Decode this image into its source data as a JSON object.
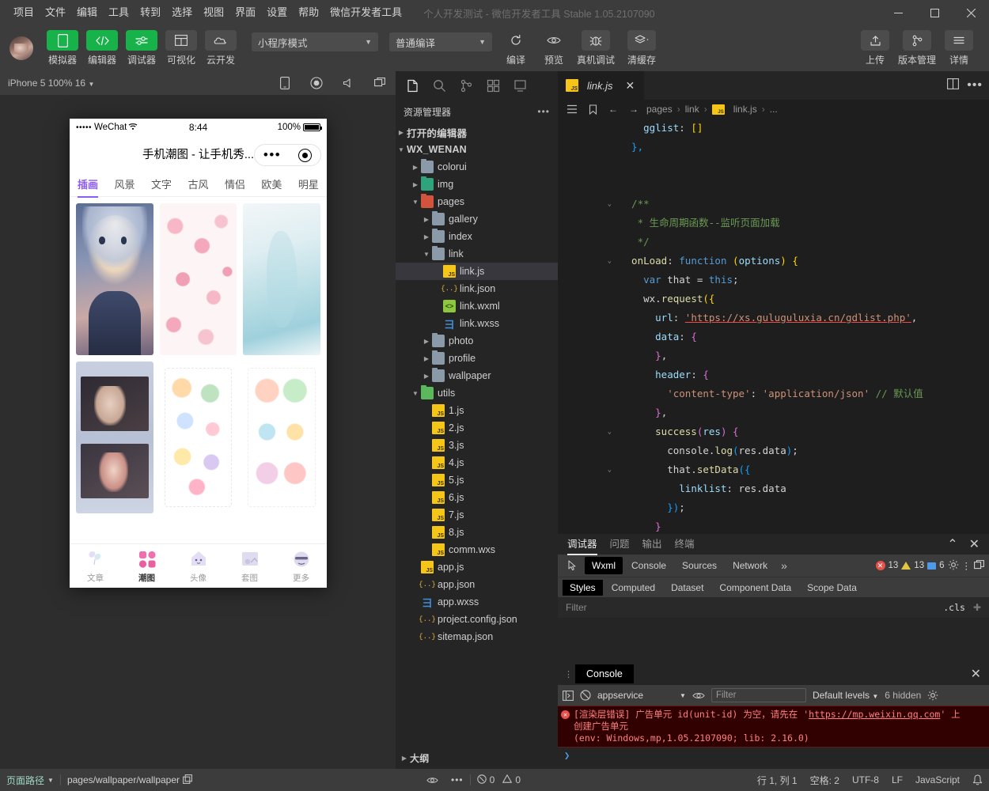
{
  "titlebar": {
    "menus": [
      "项目",
      "文件",
      "编辑",
      "工具",
      "转到",
      "选择",
      "视图",
      "界面",
      "设置",
      "帮助",
      "微信开发者工具"
    ],
    "window_title": "个人开发测试 - 微信开发者工具 Stable 1.05.2107090",
    "minimize": "minimize-icon",
    "maximize": "maximize-icon",
    "close": "close-icon"
  },
  "toolbar": {
    "avatar": "user-avatar",
    "left_buttons": [
      {
        "label": "模拟器",
        "icon": "phone-icon",
        "active": true
      },
      {
        "label": "编辑器",
        "icon": "code-icon",
        "active": true
      },
      {
        "label": "调试器",
        "icon": "debug-icon",
        "active": true
      },
      {
        "label": "可视化",
        "icon": "layout-icon",
        "active": false
      },
      {
        "label": "云开发",
        "icon": "cloud-icon",
        "active": false
      }
    ],
    "mode_select": "小程序模式",
    "compile_select": "普通编译",
    "mid_buttons": [
      {
        "label": "编译",
        "icon": "refresh-icon"
      },
      {
        "label": "预览",
        "icon": "eye-icon"
      },
      {
        "label": "真机调试",
        "icon": "bug-icon"
      },
      {
        "label": "清缓存",
        "icon": "layers-icon"
      }
    ],
    "right_buttons": [
      {
        "label": "上传",
        "icon": "upload-icon"
      },
      {
        "label": "版本管理",
        "icon": "branch-icon"
      },
      {
        "label": "详情",
        "icon": "details-icon"
      }
    ]
  },
  "simulator": {
    "device_label": "iPhone 5 100% 16",
    "toolbar_icons": [
      "rotate-device-icon",
      "record-icon",
      "volume-icon",
      "window-icon"
    ],
    "phone": {
      "status": {
        "signal": "•••••",
        "carrier": "WeChat",
        "wifi": "wifi-icon",
        "time": "8:44",
        "battery_pct": "100%"
      },
      "nav_title": "手机潮图 - 让手机秀...",
      "capsule": {
        "more": "more-dots-icon",
        "target": "target-icon"
      },
      "tabs": [
        "插画",
        "风景",
        "文字",
        "古风",
        "情侣",
        "欧美",
        "明星"
      ],
      "active_tab": "插画",
      "accent": "#8b5cf6",
      "tabbar": [
        {
          "label": "文章",
          "icon": "balloon-icon",
          "active": false
        },
        {
          "label": "潮图",
          "icon": "grid-icon",
          "active": true
        },
        {
          "label": "头像",
          "icon": "ghost-icon",
          "active": false
        },
        {
          "label": "套图",
          "icon": "album-icon",
          "active": false
        },
        {
          "label": "更多",
          "icon": "emoji-icon",
          "active": false
        }
      ]
    }
  },
  "explorer": {
    "activity_icons": [
      "files-icon",
      "search-icon",
      "source-control-icon",
      "extensions-icon",
      "debug-alt-icon"
    ],
    "title": "资源管理器",
    "more": "ellipsis-icon",
    "open_editors": "打开的编辑器",
    "project_root": "WX_WENAN",
    "tree": [
      {
        "label": "colorui",
        "type": "folder",
        "depth": 1,
        "expanded": false,
        "color": "blue"
      },
      {
        "label": "img",
        "type": "folder",
        "depth": 1,
        "expanded": false,
        "color": "green"
      },
      {
        "label": "pages",
        "type": "folder",
        "depth": 1,
        "expanded": true,
        "color": "red"
      },
      {
        "label": "gallery",
        "type": "folder",
        "depth": 2,
        "expanded": false,
        "color": "blue"
      },
      {
        "label": "index",
        "type": "folder",
        "depth": 2,
        "expanded": false,
        "color": "blue"
      },
      {
        "label": "link",
        "type": "folder",
        "depth": 2,
        "expanded": true,
        "color": "blue"
      },
      {
        "label": "link.js",
        "type": "js",
        "depth": 3,
        "selected": true
      },
      {
        "label": "link.json",
        "type": "json",
        "depth": 3
      },
      {
        "label": "link.wxml",
        "type": "wxml",
        "depth": 3
      },
      {
        "label": "link.wxss",
        "type": "wxss",
        "depth": 3
      },
      {
        "label": "photo",
        "type": "folder",
        "depth": 2,
        "expanded": false,
        "color": "blue"
      },
      {
        "label": "profile",
        "type": "folder",
        "depth": 2,
        "expanded": false,
        "color": "blue"
      },
      {
        "label": "wallpaper",
        "type": "folder",
        "depth": 2,
        "expanded": false,
        "color": "blue"
      },
      {
        "label": "utils",
        "type": "folder",
        "depth": 1,
        "expanded": true,
        "color": "lgreen"
      },
      {
        "label": "1.js",
        "type": "js",
        "depth": 2
      },
      {
        "label": "2.js",
        "type": "js",
        "depth": 2
      },
      {
        "label": "3.js",
        "type": "js",
        "depth": 2
      },
      {
        "label": "4.js",
        "type": "js",
        "depth": 2
      },
      {
        "label": "5.js",
        "type": "js",
        "depth": 2
      },
      {
        "label": "6.js",
        "type": "js",
        "depth": 2
      },
      {
        "label": "7.js",
        "type": "js",
        "depth": 2
      },
      {
        "label": "8.js",
        "type": "js",
        "depth": 2
      },
      {
        "label": "comm.wxs",
        "type": "js",
        "depth": 2
      },
      {
        "label": "app.js",
        "type": "js",
        "depth": 1
      },
      {
        "label": "app.json",
        "type": "json",
        "depth": 1
      },
      {
        "label": "app.wxss",
        "type": "wxss",
        "depth": 1
      },
      {
        "label": "project.config.json",
        "type": "json",
        "depth": 1
      },
      {
        "label": "sitemap.json",
        "type": "json",
        "depth": 1
      }
    ],
    "outline": "大纲"
  },
  "editor": {
    "tab": {
      "label": "link.js",
      "icon": "js-file-icon",
      "close": "close-icon"
    },
    "tab_actions": [
      "split-editor-icon",
      "more-actions-icon"
    ],
    "toolbar_icons": [
      "outline-icon",
      "bookmark-icon",
      "back-icon",
      "forward-icon"
    ],
    "breadcrumb": [
      "pages",
      "link",
      "link.js",
      "..."
    ],
    "lines": [
      {
        "no": "",
        "fold": "",
        "segs": [
          {
            "t": "    ",
            "c": "pl"
          },
          {
            "t": "gglist",
            "c": "prop"
          },
          {
            "t": ": ",
            "c": "pl"
          },
          {
            "t": "[]",
            "c": "br1"
          }
        ]
      },
      {
        "no": "",
        "fold": "",
        "segs": [
          {
            "t": "  },",
            "c": "br3"
          }
        ]
      },
      {
        "no": "",
        "fold": "",
        "segs": []
      },
      {
        "no": "",
        "fold": "",
        "segs": []
      },
      {
        "no": "",
        "fold": "v",
        "segs": [
          {
            "t": "  /**",
            "c": "cmt"
          }
        ]
      },
      {
        "no": "",
        "fold": "",
        "segs": [
          {
            "t": "   * 生命周期函数--监听页面加载",
            "c": "cmt"
          }
        ]
      },
      {
        "no": "",
        "fold": "",
        "segs": [
          {
            "t": "   */",
            "c": "cmt"
          }
        ]
      },
      {
        "no": "",
        "fold": "v",
        "segs": [
          {
            "t": "  onLoad",
            "c": "fn"
          },
          {
            "t": ": ",
            "c": "pl"
          },
          {
            "t": "function",
            "c": "kw"
          },
          {
            "t": " (",
            "c": "br1"
          },
          {
            "t": "options",
            "c": "prop"
          },
          {
            "t": ") ",
            "c": "br1"
          },
          {
            "t": "{",
            "c": "br1"
          }
        ]
      },
      {
        "no": "",
        "fold": "",
        "segs": [
          {
            "t": "    ",
            "c": "pl"
          },
          {
            "t": "var",
            "c": "kw"
          },
          {
            "t": " that ",
            "c": "pl"
          },
          {
            "t": "= ",
            "c": "pl"
          },
          {
            "t": "this",
            "c": "kw"
          },
          {
            "t": ";",
            "c": "pl"
          }
        ]
      },
      {
        "no": "",
        "fold": "",
        "segs": [
          {
            "t": "    wx.",
            "c": "pl"
          },
          {
            "t": "request",
            "c": "fn"
          },
          {
            "t": "({",
            "c": "br1"
          }
        ]
      },
      {
        "no": "",
        "fold": "",
        "segs": [
          {
            "t": "      ",
            "c": "pl"
          },
          {
            "t": "url",
            "c": "prop"
          },
          {
            "t": ": ",
            "c": "pl"
          },
          {
            "t": "'https://xs.guluguluxia.cn/gdlist.php'",
            "c": "str ulink"
          },
          {
            "t": ",",
            "c": "pl"
          }
        ]
      },
      {
        "no": "",
        "fold": "",
        "segs": [
          {
            "t": "      ",
            "c": "pl"
          },
          {
            "t": "data",
            "c": "prop"
          },
          {
            "t": ": ",
            "c": "pl"
          },
          {
            "t": "{",
            "c": "br2"
          }
        ]
      },
      {
        "no": "",
        "fold": "",
        "segs": [
          {
            "t": "      ",
            "c": "pl"
          },
          {
            "t": "}",
            "c": "br2"
          },
          {
            "t": ",",
            "c": "pl"
          }
        ]
      },
      {
        "no": "",
        "fold": "",
        "segs": [
          {
            "t": "      ",
            "c": "pl"
          },
          {
            "t": "header",
            "c": "prop"
          },
          {
            "t": ": ",
            "c": "pl"
          },
          {
            "t": "{",
            "c": "br2"
          }
        ]
      },
      {
        "no": "",
        "fold": "",
        "segs": [
          {
            "t": "        ",
            "c": "pl"
          },
          {
            "t": "'content-type'",
            "c": "str"
          },
          {
            "t": ": ",
            "c": "pl"
          },
          {
            "t": "'application/json'",
            "c": "str"
          },
          {
            "t": " ",
            "c": "pl"
          },
          {
            "t": "// 默认值",
            "c": "cmt"
          }
        ]
      },
      {
        "no": "",
        "fold": "",
        "segs": [
          {
            "t": "      ",
            "c": "pl"
          },
          {
            "t": "}",
            "c": "br2"
          },
          {
            "t": ",",
            "c": "pl"
          }
        ]
      },
      {
        "no": "",
        "fold": "v",
        "segs": [
          {
            "t": "      ",
            "c": "pl"
          },
          {
            "t": "success",
            "c": "fn"
          },
          {
            "t": "(",
            "c": "br2"
          },
          {
            "t": "res",
            "c": "prop"
          },
          {
            "t": ") ",
            "c": "br2"
          },
          {
            "t": "{",
            "c": "br2"
          }
        ]
      },
      {
        "no": "",
        "fold": "",
        "segs": [
          {
            "t": "        console.",
            "c": "pl"
          },
          {
            "t": "log",
            "c": "fn"
          },
          {
            "t": "(",
            "c": "br3"
          },
          {
            "t": "res.data",
            "c": "pl"
          },
          {
            "t": ")",
            "c": "br3"
          },
          {
            "t": ";",
            "c": "pl"
          }
        ]
      },
      {
        "no": "",
        "fold": "v",
        "segs": [
          {
            "t": "        that.",
            "c": "pl"
          },
          {
            "t": "setData",
            "c": "fn"
          },
          {
            "t": "({",
            "c": "br3"
          }
        ]
      },
      {
        "no": "",
        "fold": "",
        "segs": [
          {
            "t": "          ",
            "c": "pl"
          },
          {
            "t": "linklist",
            "c": "prop"
          },
          {
            "t": ": res.data",
            "c": "pl"
          }
        ]
      },
      {
        "no": "",
        "fold": "",
        "segs": [
          {
            "t": "        ",
            "c": "pl"
          },
          {
            "t": "})",
            "c": "br3"
          },
          {
            "t": ";",
            "c": "pl"
          }
        ]
      },
      {
        "no": "",
        "fold": "",
        "segs": [
          {
            "t": "      ",
            "c": "pl"
          },
          {
            "t": "}",
            "c": "br2"
          }
        ]
      },
      {
        "no": "",
        "fold": "",
        "segs": [
          {
            "t": "    ",
            "c": "pl"
          },
          {
            "t": "})",
            "c": "br1"
          }
        ]
      }
    ]
  },
  "debugger": {
    "tabs": [
      "调试器",
      "问题",
      "输出",
      "终端"
    ],
    "active_tab": "调试器",
    "panel_actions": [
      "collapse-icon",
      "close-icon"
    ],
    "devtool_tabs": [
      "Wxml",
      "Console",
      "Sources",
      "Network"
    ],
    "active_devtool": "Wxml",
    "inspect_icon": "inspect-element-icon",
    "overflow": "»",
    "badges": {
      "errors": "13",
      "warnings": "13",
      "info": "6"
    },
    "badge_colors": {
      "error": "#e5534b",
      "warning": "#e2c541",
      "info": "#4f9ae8"
    },
    "right_icons": [
      "gear-icon",
      "kebab-icon",
      "dock-icon"
    ],
    "style_tabs": [
      "Styles",
      "Computed",
      "Dataset",
      "Component Data",
      "Scope Data"
    ],
    "active_style_tab": "Styles",
    "filter_placeholder": "Filter",
    "cls_label": ".cls",
    "add_icon": "plus-icon"
  },
  "console": {
    "title": "Console",
    "grip": "drag-handle-icon",
    "close": "close-icon",
    "sidebar_icon": "console-sidebar-icon",
    "clear_icon": "clear-console-icon",
    "context": "appservice",
    "eye_icon": "live-expression-icon",
    "filter_placeholder": "Filter",
    "levels": "Default levels",
    "hidden": "6 hidden",
    "settings_icon": "gear-icon",
    "error": {
      "badge": "error-icon",
      "line1_pre": "[渲染层错误] 广告单元 id(unit-id) 为空，请先在 ",
      "link": "https://mp.weixin.qq.com",
      "line1_post": " 上",
      "line2": "创建广告单元",
      "line3": "(env: Windows,mp,1.05.2107090; lib: 2.16.0)"
    },
    "prompt": "❯"
  },
  "statusbar": {
    "page_path_label": "页面路径",
    "page_path": "pages/wallpaper/wallpaper",
    "copy_icon": "copy-icon",
    "eye_icon": "eye-icon",
    "more_icon": "ellipsis-icon",
    "error_count": "0",
    "warning_count": "0",
    "cursor": "行 1, 列 1",
    "spaces": "空格: 2",
    "encoding": "UTF-8",
    "eol": "LF",
    "language": "JavaScript",
    "bell": "bell-icon"
  }
}
